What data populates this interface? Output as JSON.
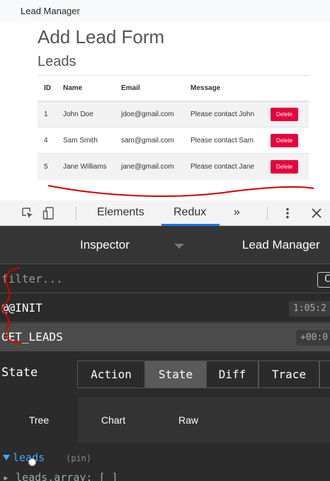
{
  "app": {
    "brand": "Lead Manager",
    "form_title": "Add Lead Form",
    "leads_title": "Leads",
    "table": {
      "headers": [
        "ID",
        "Name",
        "Email",
        "Message",
        ""
      ],
      "rows": [
        {
          "id": "1",
          "name": "John Doe",
          "email": "jdoe@gmail.com",
          "message": "Please contact John",
          "action": "Delete"
        },
        {
          "id": "4",
          "name": "Sam Smith",
          "email": "sam@gmail.com",
          "message": "Please contact Sam",
          "action": "Delete"
        },
        {
          "id": "5",
          "name": "Jane Williams",
          "email": "jane@gmail.com",
          "message": "Please contact Jane",
          "action": "Delete"
        }
      ]
    },
    "delete_color": "#e8003e",
    "annotation_color": "#d10000"
  },
  "devtools": {
    "tabs": [
      "Elements",
      "Redux",
      "»"
    ],
    "active_tab": "Redux",
    "icons": [
      "inspect-element-icon",
      "device-toolbar-icon",
      "more-vert-icon",
      "close-icon"
    ],
    "accent_color": "#1a73e8",
    "redux": {
      "monitor": "Inspector",
      "store": "Lead Manager",
      "filter_placeholder": "filter...",
      "commit_label": "C",
      "actions": [
        {
          "type": "@@INIT",
          "time": "1:05:2"
        },
        {
          "type": "GET_LEADS",
          "time": "+00:0"
        }
      ],
      "panel_label": "State",
      "segments": [
        "Action",
        "State",
        "Diff",
        "Trace"
      ],
      "active_segment": "State",
      "subtabs": [
        "Tree",
        "Chart",
        "Raw"
      ],
      "active_subtab": "Tree",
      "tree": {
        "key": "leads",
        "pin": "(pin)",
        "child": "▸ leads.array: [ ]"
      }
    }
  }
}
